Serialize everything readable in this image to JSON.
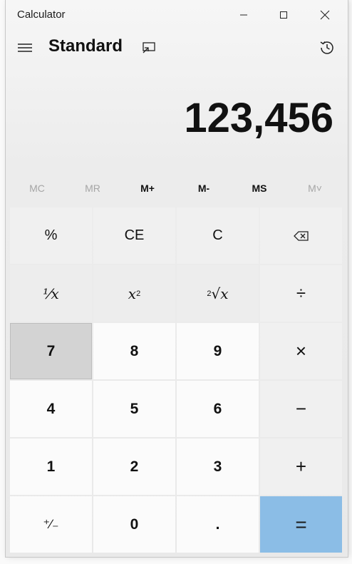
{
  "window": {
    "app_title": "Calculator",
    "mode_title": "Standard"
  },
  "display": {
    "value": "123,456"
  },
  "memory": [
    {
      "label": "MC",
      "enabled": false
    },
    {
      "label": "MR",
      "enabled": false
    },
    {
      "label": "M+",
      "enabled": true
    },
    {
      "label": "M-",
      "enabled": true
    },
    {
      "label": "MS",
      "enabled": true
    },
    {
      "label": "M˅",
      "enabled": false
    }
  ],
  "keys": {
    "percent": "%",
    "ce": "CE",
    "c": "C",
    "backspace": "backspace-icon",
    "reciprocal": "⅟x",
    "square_base": "x",
    "square_exp": "2",
    "sqrt_index": "2",
    "sqrt_base": "√x",
    "divide": "÷",
    "d7": "7",
    "d8": "8",
    "d9": "9",
    "multiply": "×",
    "d4": "4",
    "d5": "5",
    "d6": "6",
    "minus": "−",
    "d1": "1",
    "d2": "2",
    "d3": "3",
    "plus": "+",
    "negate": "⁺∕₋",
    "d0": "0",
    "decimal": ".",
    "equals": "="
  },
  "colors": {
    "equals_bg": "#8bbde6",
    "pressed_key": "#d3d3d3"
  },
  "icons": [
    "hamburger-icon",
    "keep-on-top-icon",
    "history-icon",
    "minimize-icon",
    "maximize-icon",
    "close-icon",
    "backspace-icon"
  ]
}
